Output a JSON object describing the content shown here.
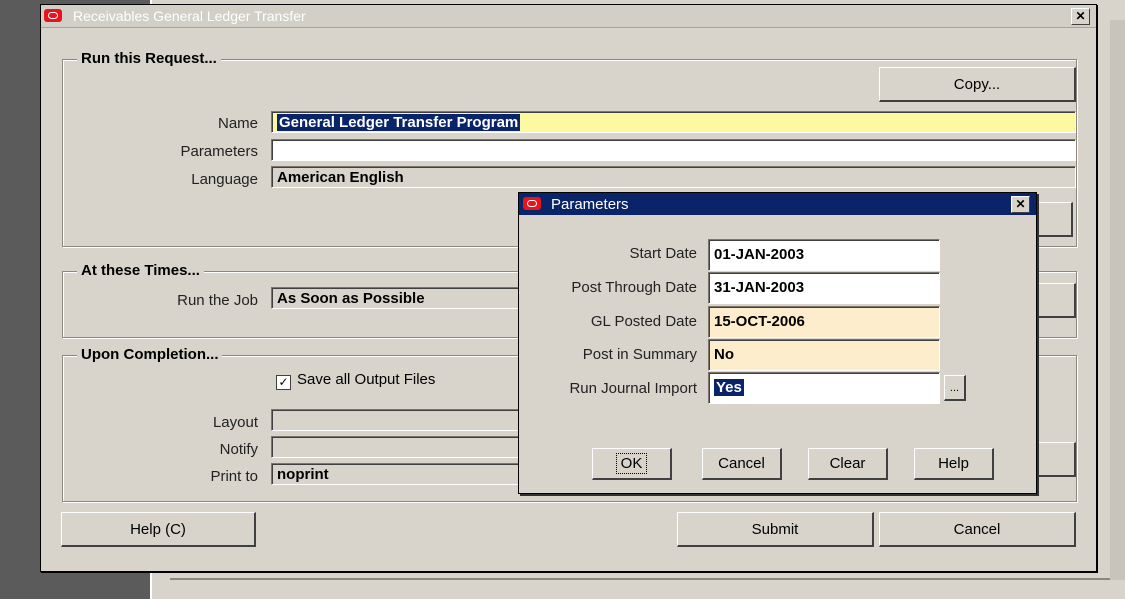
{
  "main_window": {
    "title": "Receivables General Ledger Transfer",
    "close_glyph": "✕"
  },
  "run_request": {
    "heading": "Run this Request...",
    "copy_button": "Copy...",
    "name_label": "Name",
    "name_value": "General Ledger Transfer Program",
    "parameters_label": "Parameters",
    "parameters_value": "",
    "language_label": "Language",
    "language_value": "American English"
  },
  "at_these_times": {
    "heading": "At these Times...",
    "run_job_label": "Run the Job",
    "run_job_value": "As Soon as Possible"
  },
  "upon_completion": {
    "heading": "Upon Completion...",
    "save_output_label": "Save all Output Files",
    "save_output_checked": true,
    "layout_label": "Layout",
    "layout_value": "",
    "notify_label": "Notify",
    "notify_value": "",
    "print_to_label": "Print to",
    "print_to_value": "noprint"
  },
  "footer": {
    "help_button": "Help (C)",
    "submit_button": "Submit",
    "cancel_button": "Cancel"
  },
  "parameters_dialog": {
    "title": "Parameters",
    "close_glyph": "✕",
    "fields": [
      {
        "label": "Start Date",
        "value": "01-JAN-2003"
      },
      {
        "label": "Post Through Date",
        "value": "31-JAN-2003"
      },
      {
        "label": "GL Posted Date",
        "value": "15-OCT-2006"
      },
      {
        "label": "Post in Summary",
        "value": "No"
      },
      {
        "label": "Run Journal Import",
        "value": "Yes"
      }
    ],
    "lov_button": "...",
    "ok_button": "OK",
    "cancel_button": "Cancel",
    "clear_button": "Clear",
    "help_button": "Help"
  },
  "colors": {
    "required_field": "#fdf9a0",
    "readonly_field": "#fdedcc",
    "selection": "#0a246a",
    "oracle_red": "#e8141c"
  }
}
